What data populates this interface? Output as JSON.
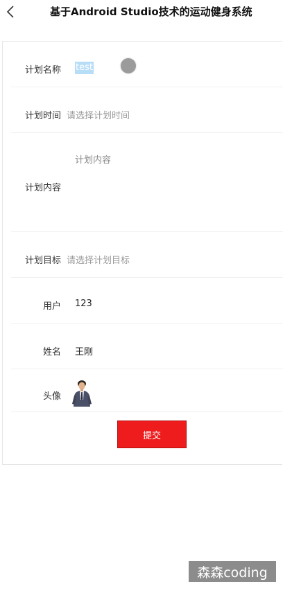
{
  "header": {
    "title": "基于Android Studio技术的运动健身系统"
  },
  "form": {
    "plan_name": {
      "label": "计划名称",
      "value": "test"
    },
    "plan_time": {
      "label": "计划时间",
      "placeholder": "请选择计划时间"
    },
    "plan_content": {
      "label": "计划内容",
      "placeholder": "计划内容"
    },
    "plan_target": {
      "label": "计划目标",
      "placeholder": "请选择计划目标"
    },
    "user": {
      "label": "用户",
      "value": "123"
    },
    "real_name": {
      "label": "姓名",
      "value": "王刚"
    },
    "avatar": {
      "label": "头像"
    },
    "submit_label": "提交"
  },
  "watermark": "森森coding",
  "icons": {
    "back": "chevron-left-icon",
    "avatar": "person-avatar"
  },
  "colors": {
    "submit_bg": "#ee1c1c",
    "placeholder": "#9a9a9a",
    "selection": "#b7ddf7"
  }
}
